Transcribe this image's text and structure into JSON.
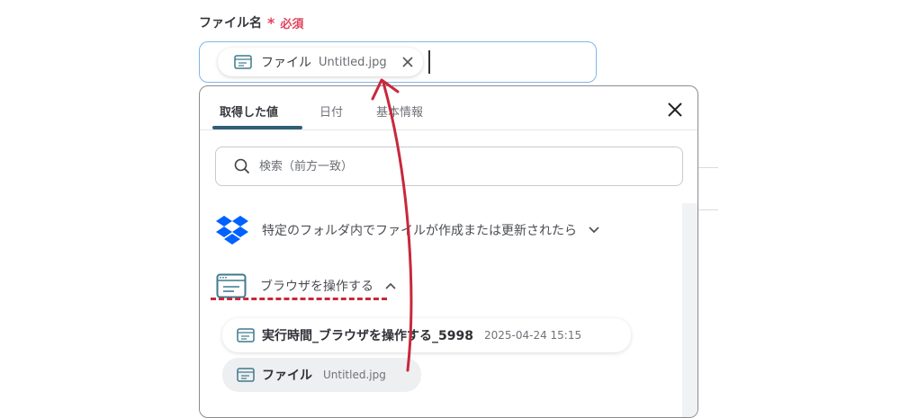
{
  "field": {
    "label": "ファイル名",
    "required_mark": "*",
    "required_text": "必須"
  },
  "chip": {
    "name": "ファイル",
    "value": "Untitled.jpg"
  },
  "popup": {
    "tabs": [
      {
        "label": "取得した値",
        "active": true
      },
      {
        "label": "日付",
        "active": false
      },
      {
        "label": "基本情報",
        "active": false
      }
    ],
    "search_placeholder": "検索（前方一致）",
    "sections": [
      {
        "title": "特定のフォルダ内でファイルが作成または更新されたら",
        "icon": "dropbox-icon",
        "expanded": false
      },
      {
        "title": "ブラウザを操作する",
        "icon": "browser-window-icon",
        "expanded": true
      }
    ],
    "items": [
      {
        "label": "実行時間_ブラウザを操作する_5998",
        "value": "2025-04-24 15:15"
      },
      {
        "label": "ファイル",
        "value": "Untitled.jpg"
      }
    ]
  },
  "colors": {
    "accent_tab": "#2f5f76",
    "required": "#e0445c",
    "annotation_red": "#c8283c",
    "input_focus_border": "#7fb6ee",
    "dropbox_blue": "#0061fe"
  }
}
